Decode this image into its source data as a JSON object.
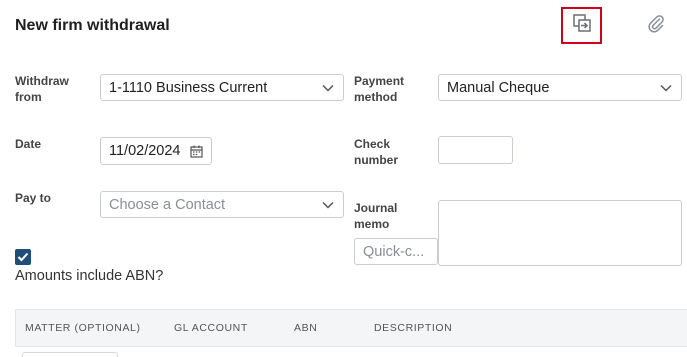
{
  "header": {
    "title": "New firm withdrawal"
  },
  "form": {
    "withdraw_from": {
      "label": "Withdraw\nfrom",
      "value": "1-1110 Business Current"
    },
    "payment_method": {
      "label": "Payment\nmethod",
      "value": "Manual Cheque"
    },
    "date": {
      "label": "Date",
      "value": "11/02/2024"
    },
    "check_number": {
      "label": "Check\nnumber",
      "value": ""
    },
    "pay_to": {
      "label": "Pay to",
      "placeholder": "Choose a Contact"
    },
    "journal_memo": {
      "label": "Journal\nmemo",
      "value": ""
    },
    "quick_code": {
      "placeholder": "Quick-c..."
    },
    "amounts_include_abn": {
      "checked": true,
      "label": "Amounts include ABN?"
    }
  },
  "table": {
    "columns": [
      "MATTER (OPTIONAL)",
      "GL ACCOUNT",
      "ABN",
      "DESCRIPTION"
    ]
  },
  "colors": {
    "highlight": "#d0021b",
    "checkbox": "#1f4e79"
  },
  "icons": {
    "copy": "copy-icon",
    "attach": "paperclip-icon",
    "calendar": "calendar-icon",
    "chevron": "chevron-down-icon",
    "check": "checkmark-icon"
  }
}
